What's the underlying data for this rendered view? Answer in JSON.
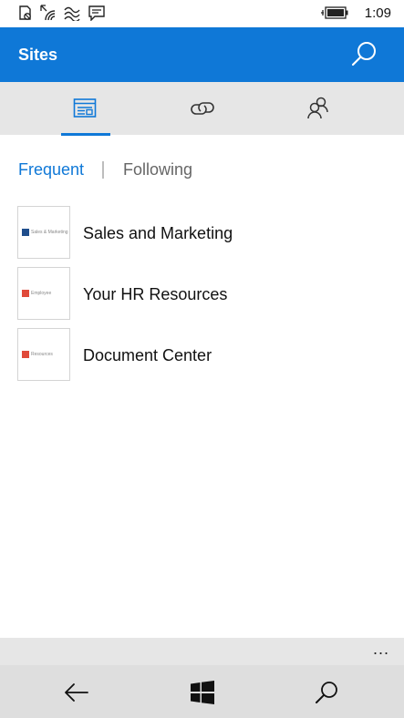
{
  "status_bar": {
    "time": "1:09",
    "icons": [
      "notification-icon",
      "wifi-icon",
      "network-icon",
      "message-icon",
      "battery-icon"
    ]
  },
  "header": {
    "title": "Sites",
    "search_icon": "search-icon",
    "color": "#0f78d7"
  },
  "tabs": [
    {
      "icon": "sites-icon",
      "selected": true
    },
    {
      "icon": "link-icon",
      "selected": false
    },
    {
      "icon": "people-icon",
      "selected": false
    }
  ],
  "filters": {
    "frequent": "Frequent",
    "following": "Following",
    "selected": "Frequent"
  },
  "sites": [
    {
      "name": "Sales and Marketing",
      "thumb_text": "Sales & Marketing",
      "thumb_color": "#1f4e8c"
    },
    {
      "name": "Your HR Resources",
      "thumb_text": "Employee",
      "thumb_color": "#e04a3a"
    },
    {
      "name": "Document Center",
      "thumb_text": "Resources",
      "thumb_color": "#e04a3a"
    }
  ],
  "app_bar": {
    "more_label": "..."
  },
  "nav_bar": {
    "icons": [
      "back-arrow-icon",
      "windows-logo-icon",
      "search-icon"
    ]
  },
  "colors": {
    "accent": "#0f78d7",
    "tabbar": "#e6e6e6",
    "navbar": "#dedede"
  }
}
